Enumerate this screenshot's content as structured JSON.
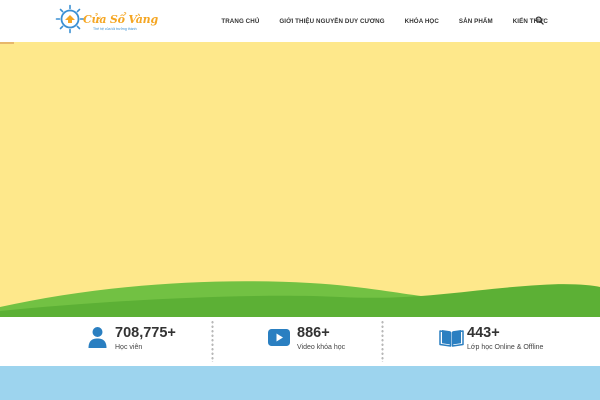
{
  "brand": {
    "name": "Cửa Sổ Vàng",
    "tagline": "Thế hệ của tôi trưởng thành",
    "accent_color": "#f5a623",
    "secondary_color": "#3a8fd3"
  },
  "nav": {
    "items": [
      "TRANG CHỦ",
      "GIỚI THIỆU NGUYỄN DUY CƯƠNG",
      "KHÓA HỌC",
      "SẢN PHẨM",
      "KIẾN THỨC"
    ],
    "search_icon": "search-icon"
  },
  "hero": {
    "background_color": "#fee88b",
    "hill_colors": [
      "#5cb035",
      "#72c143"
    ]
  },
  "stats": [
    {
      "value": "708,775+",
      "label": "Học viên",
      "icon": "user-icon"
    },
    {
      "value": "886+",
      "label": "Video khóa học",
      "icon": "play-icon"
    },
    {
      "value": "443+",
      "label": "Lớp học Online & Offline",
      "icon": "book-icon"
    }
  ],
  "colors": {
    "icon_blue": "#2a7fc1",
    "bottom_band": "#9dd4ee"
  }
}
